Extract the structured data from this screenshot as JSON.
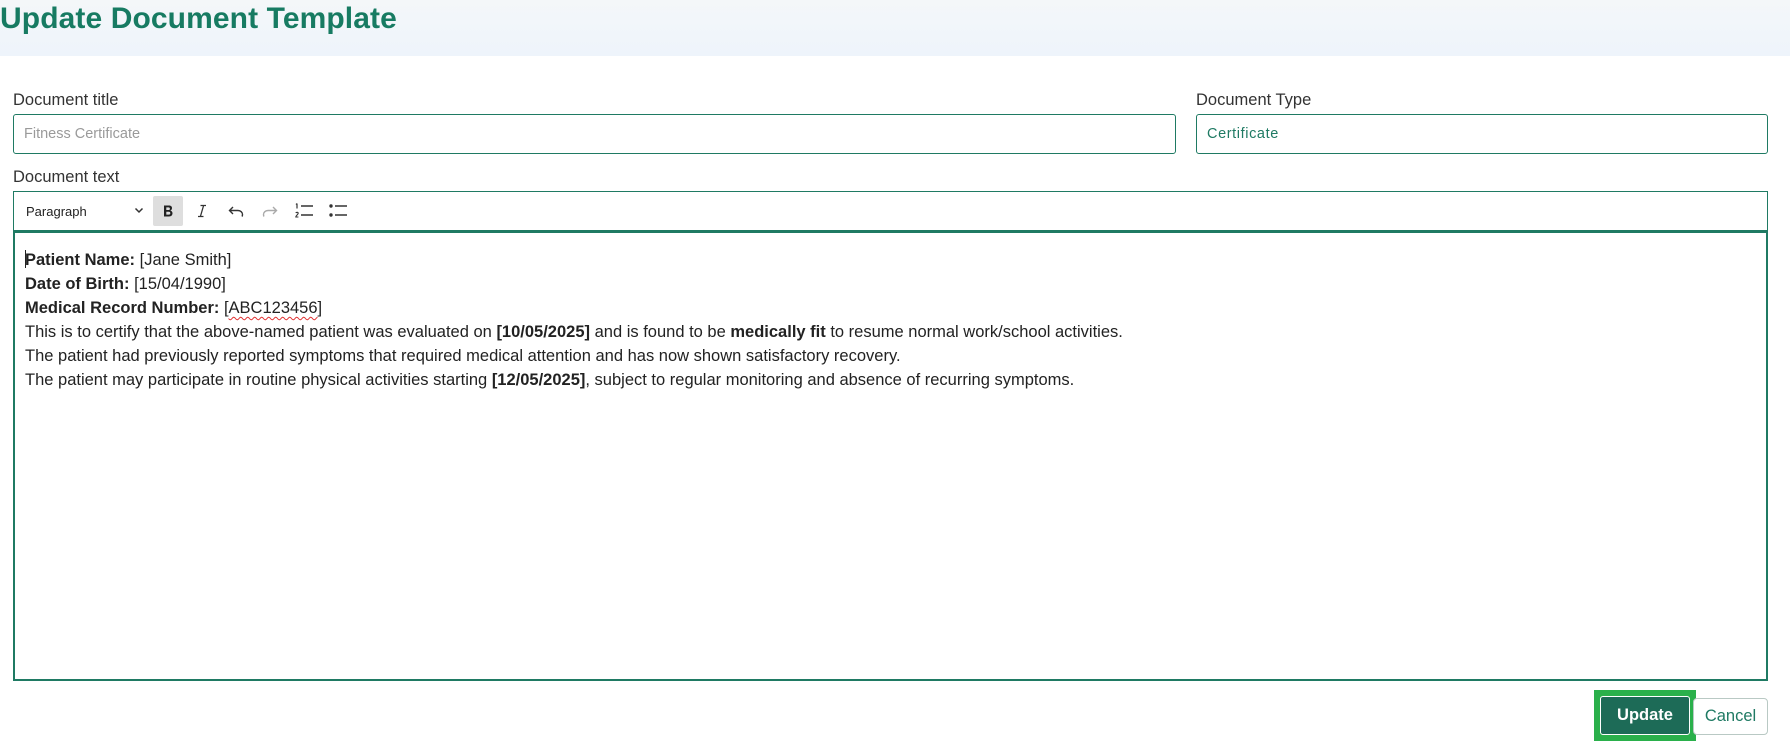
{
  "page": {
    "title": "Update Document Template"
  },
  "form": {
    "title_label": "Document title",
    "title_placeholder": "Fitness Certificate",
    "title_value": "",
    "type_label": "Document Type",
    "type_value": "Certificate",
    "text_label": "Document text"
  },
  "toolbar": {
    "block_style": "Paragraph",
    "icons": [
      "chevron-down-icon",
      "bold-icon",
      "italic-icon",
      "undo-icon",
      "redo-icon",
      "numbered-list-icon",
      "bulleted-list-icon"
    ]
  },
  "editor": {
    "line1": {
      "label": "Patient Name:",
      "value": " [Jane Smith]"
    },
    "line2": {
      "label": "Date of Birth:",
      "value": " [15/04/1990]"
    },
    "line3": {
      "label": "Medical Record Number:",
      "value_pre": " [",
      "value_spell": "ABC123456",
      "value_post": "]"
    },
    "line4": {
      "t1": "This is to certify that the above-named patient was evaluated on ",
      "b1": "[10/05/2025]",
      "t2": " and is found to be ",
      "b2": "medically fit",
      "t3": " to resume normal work/school activities."
    },
    "line5": {
      "text": "The patient had previously reported symptoms that required medical attention and has now shown satisfactory recovery."
    },
    "line6": {
      "t1": "The patient may participate in routine physical activities starting ",
      "b1": "[12/05/2025]",
      "t2": ", subject to regular monitoring and absence of recurring symptoms."
    }
  },
  "actions": {
    "update_label": "Update",
    "cancel_label": "Cancel"
  },
  "colors": {
    "brand": "#177b62",
    "border": "#1f7a63",
    "button": "#1d6b57",
    "highlight": "#2ab04b"
  }
}
